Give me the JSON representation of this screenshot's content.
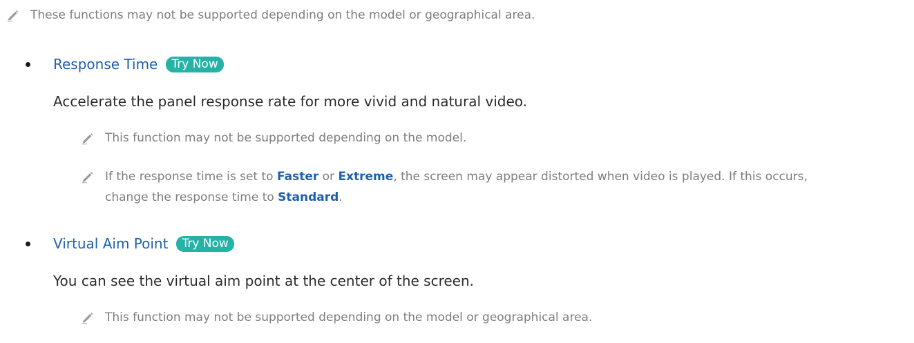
{
  "icons": {
    "note": "pencil-icon"
  },
  "colors": {
    "link": "#1d5fae",
    "badge": "#24b3a6",
    "note_text": "#7d7d7d",
    "body_text": "#2a2a2a"
  },
  "intro_note": "These functions may not be supported depending on the model or geographical area.",
  "sections": [
    {
      "title": "Response Time",
      "badge": "Try Now",
      "description": "Accelerate the panel response rate for more vivid and natural video.",
      "notes": [
        {
          "text": "This function may not be supported depending on the model."
        },
        {
          "line1_before": "If the response time is set to ",
          "hl1": "Faster",
          "between": " or ",
          "hl2": "Extreme",
          "line1_after": ", the screen may appear distorted when video is played. If this occurs,",
          "line2_before": "change the response time to ",
          "hl3": "Standard",
          "line2_after": "."
        }
      ]
    },
    {
      "title": "Virtual Aim Point",
      "badge": "Try Now",
      "description": "You can see the virtual aim point at the center of the screen.",
      "notes": [
        {
          "text": "This function may not be supported depending on the model or geographical area."
        }
      ]
    }
  ]
}
